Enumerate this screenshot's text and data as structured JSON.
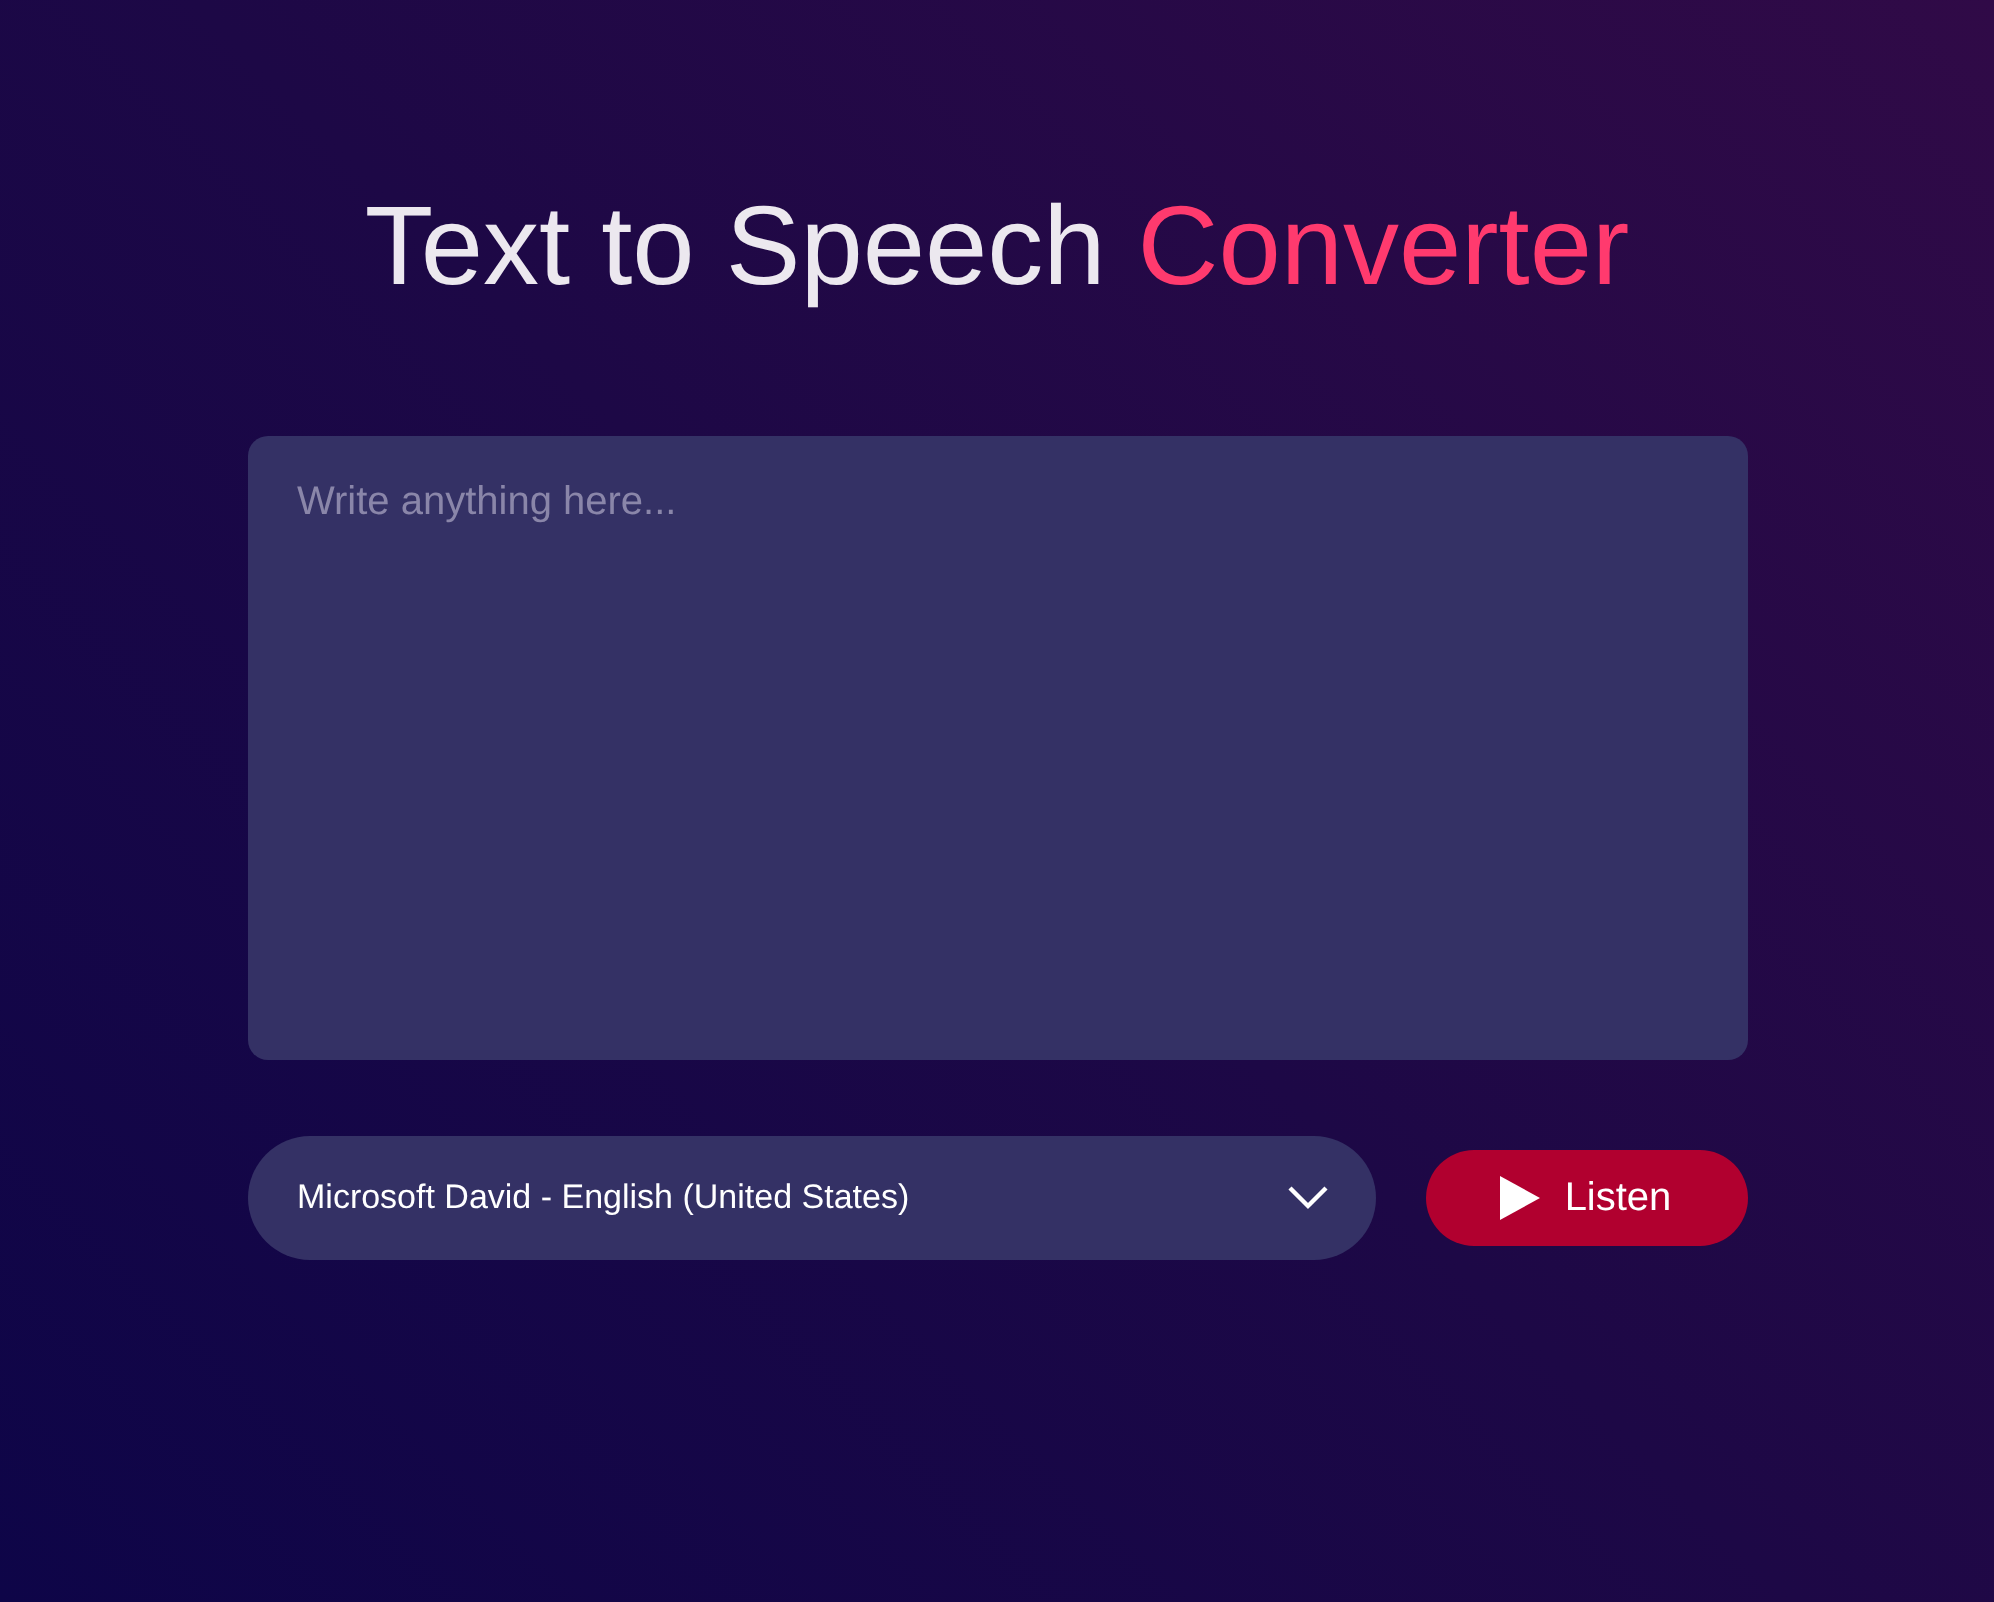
{
  "title": {
    "text": "Text to Speech",
    "highlight": "Converter"
  },
  "textarea": {
    "placeholder": "Write anything here..."
  },
  "voice_select": {
    "value": "Microsoft David - English (United States)"
  },
  "listen_button": {
    "label": "Listen"
  }
}
